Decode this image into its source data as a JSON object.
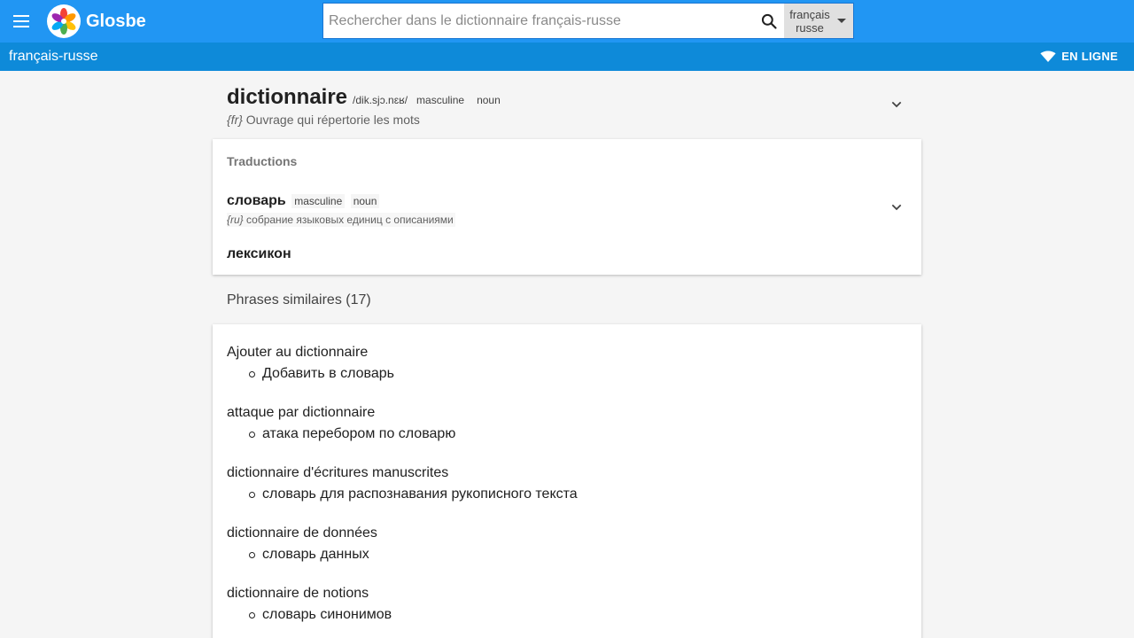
{
  "header": {
    "brand": "Glosbe",
    "search_placeholder": "Rechercher dans le dictionnaire français-russe",
    "search_value": "",
    "lang_from": "français",
    "lang_to": "russe"
  },
  "subbar": {
    "title": "français-russe",
    "status": "EN LIGNE"
  },
  "entry": {
    "headword": "dictionnaire",
    "phonetic": "/dik.sjɔ.nɛʁ/",
    "gender": "masculine",
    "pos": "noun",
    "def_lang": "{fr}",
    "definition": "Ouvrage qui répertorie les mots"
  },
  "translations": {
    "title": "Traductions",
    "items": [
      {
        "word": "словарь",
        "gender": "masculine",
        "pos": "noun",
        "def_lang": "{ru}",
        "definition": "собрание языковых единиц с описаниями"
      },
      {
        "word": "лексикон"
      }
    ]
  },
  "similar": {
    "title": "Phrases similaires (17)",
    "phrases": [
      {
        "src": "Ajouter au dictionnaire",
        "dst": "Добавить в словарь"
      },
      {
        "src": "attaque par dictionnaire",
        "dst": "атака перебором по словарю"
      },
      {
        "src": "dictionnaire d'écritures manuscrites",
        "dst": "словарь для распознавания рукописного текста"
      },
      {
        "src": "dictionnaire de données",
        "dst": "словарь данных"
      },
      {
        "src": "dictionnaire de notions",
        "dst": "словарь синонимов"
      }
    ]
  },
  "colors": {
    "topbar": "#2196f3",
    "subbar": "#0e8ad9"
  },
  "icons": [
    "menu-icon",
    "glosbe-logo",
    "search-icon",
    "dropdown-caret-icon",
    "wifi-icon",
    "chevron-down-icon"
  ]
}
